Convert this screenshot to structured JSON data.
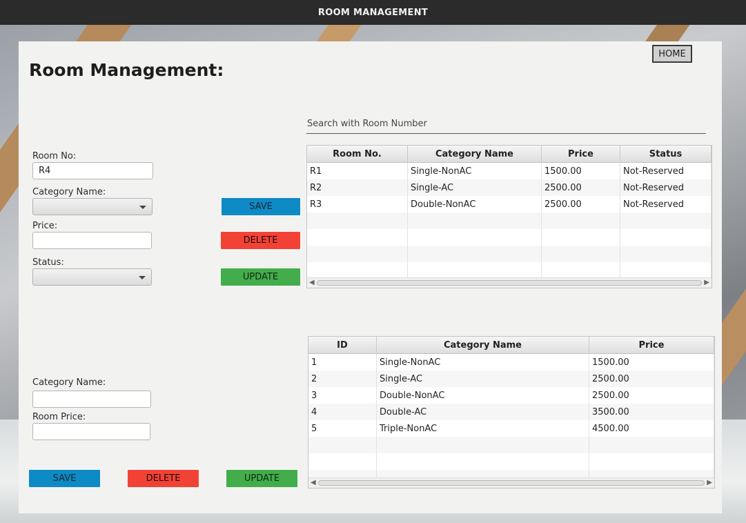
{
  "window": {
    "title": "ROOM MANAGEMENT"
  },
  "page": {
    "heading": "Room Management:",
    "home_label": "HOME"
  },
  "room_form": {
    "room_no_label": "Room No:",
    "room_no_value": "R4",
    "category_label": "Category Name:",
    "category_value": "",
    "price_label": "Price:",
    "price_value": "",
    "status_label": "Status:",
    "status_value": "",
    "save_label": "SAVE",
    "delete_label": "DELETE",
    "update_label": "UPDATE"
  },
  "room_search": {
    "placeholder": "Search with Room Number"
  },
  "rooms_table": {
    "columns": [
      "Room No.",
      "Category Name",
      "Price",
      "Status"
    ],
    "rows": [
      [
        "R1",
        "Single-NonAC",
        "1500.00",
        "Not-Reserved"
      ],
      [
        "R2",
        "Single-AC",
        "2500.00",
        "Not-Reserved"
      ],
      [
        "R3",
        "Double-NonAC",
        "2500.00",
        "Not-Reserved"
      ],
      [
        "",
        "",
        "",
        ""
      ],
      [
        "",
        "",
        "",
        ""
      ],
      [
        "",
        "",
        "",
        ""
      ],
      [
        "",
        "",
        "",
        ""
      ]
    ]
  },
  "category_form": {
    "category_label": "Category Name:",
    "category_value": "",
    "price_label": "Room Price:",
    "price_value": "",
    "save_label": "SAVE",
    "delete_label": "DELETE",
    "update_label": "UPDATE"
  },
  "categories_table": {
    "columns": [
      "ID",
      "Category Name",
      "Price"
    ],
    "rows": [
      [
        "1",
        "Single-NonAC",
        "1500.00"
      ],
      [
        "2",
        "Single-AC",
        "2500.00"
      ],
      [
        "3",
        "Double-NonAC",
        "2500.00"
      ],
      [
        "4",
        "Double-AC",
        "3500.00"
      ],
      [
        "5",
        "Triple-NonAC",
        "4500.00"
      ],
      [
        "",
        "",
        ""
      ],
      [
        "",
        "",
        ""
      ],
      [
        "",
        "",
        ""
      ]
    ]
  },
  "colors": {
    "save": "#0e8ac5",
    "delete": "#f24236",
    "update": "#43ad4b",
    "titlebar": "#2b2b2b"
  }
}
